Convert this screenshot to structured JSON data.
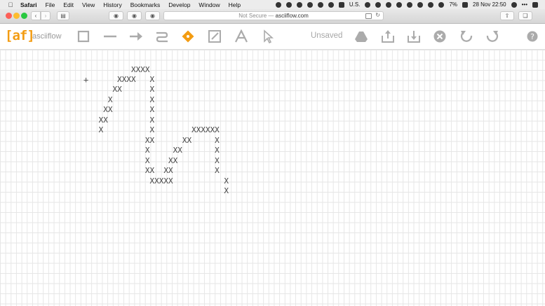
{
  "menubar": {
    "app": "Safari",
    "items": [
      "File",
      "Edit",
      "View",
      "History",
      "Bookmarks",
      "Develop",
      "Window",
      "Help"
    ],
    "status": {
      "locale": "U.S.",
      "battery": "7%",
      "datetime": "28 Nov  22:50"
    }
  },
  "browser": {
    "url_prefix": "Not Secure —",
    "url_host": "asciiflow.com"
  },
  "app": {
    "logo_text": "[af]",
    "brand": "asciiflow",
    "save_status": "Unsaved",
    "tools": [
      "box-tool",
      "line-tool",
      "arrow-tool",
      "freeform-tool",
      "erase-tool",
      "resize-tool",
      "text-tool",
      "select-tool"
    ],
    "actions": [
      "drive-icon",
      "import-icon",
      "export-icon",
      "clear-icon",
      "undo-icon",
      "redo-icon",
      "help-icon"
    ],
    "accent": "#f39c12"
  },
  "canvas": {
    "lines": [
      "        XXXX",
      "     XXXX   X",
      "    XX      X",
      "   X        X",
      "  XX        X",
      " XX         X",
      " X          X        XXXXXX",
      "           XX      XX     X",
      "           X     XX       X",
      "           X    XX        X",
      "           XX  XX         X",
      "            XXXXX           X",
      "                            X"
    ]
  }
}
